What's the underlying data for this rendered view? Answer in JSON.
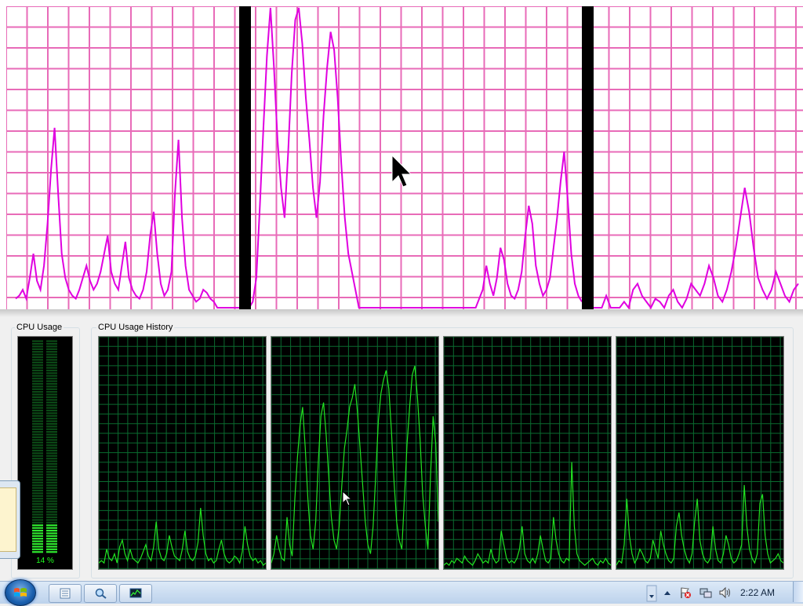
{
  "window": {
    "cpu_usage_label": "CPU Usage",
    "cpu_usage_history_label": "CPU Usage History",
    "cpu_percent_text": "14 %",
    "cpu_percent_value": 14
  },
  "colors": {
    "graph_line": "#21e321",
    "graph_grid": "#0a6b2f",
    "zoom_line": "#e000e0",
    "zoom_grid": "#e86bb8"
  },
  "history": {
    "core_0": [
      2,
      3,
      2,
      8,
      4,
      3,
      6,
      2,
      9,
      12,
      6,
      3,
      8,
      4,
      3,
      2,
      4,
      7,
      10,
      5,
      3,
      9,
      20,
      8,
      4,
      3,
      6,
      14,
      9,
      5,
      4,
      3,
      8,
      16,
      7,
      4,
      3,
      5,
      11,
      26,
      14,
      6,
      3,
      4,
      2,
      3,
      8,
      12,
      6,
      3,
      2,
      3,
      5,
      4,
      2,
      7,
      18,
      10,
      5,
      3,
      4,
      2,
      3,
      1,
      2
    ],
    "core_1": [
      2,
      6,
      14,
      8,
      4,
      3,
      22,
      10,
      5,
      30,
      48,
      62,
      70,
      52,
      30,
      14,
      8,
      20,
      46,
      66,
      72,
      58,
      40,
      22,
      12,
      8,
      18,
      36,
      52,
      60,
      70,
      74,
      80,
      68,
      52,
      36,
      20,
      10,
      6,
      18,
      40,
      64,
      76,
      82,
      86,
      78,
      60,
      38,
      20,
      12,
      8,
      30,
      54,
      70,
      84,
      88,
      74,
      56,
      32,
      18,
      8,
      40,
      66,
      54,
      20
    ],
    "core_2": [
      1,
      2,
      1,
      3,
      2,
      4,
      3,
      2,
      5,
      3,
      2,
      1,
      3,
      6,
      4,
      2,
      3,
      2,
      8,
      4,
      2,
      3,
      16,
      10,
      4,
      2,
      3,
      2,
      4,
      8,
      18,
      6,
      3,
      2,
      4,
      2,
      6,
      14,
      8,
      3,
      2,
      4,
      22,
      12,
      6,
      3,
      2,
      4,
      3,
      46,
      18,
      6,
      3,
      2,
      1,
      2,
      3,
      4,
      2,
      1,
      3,
      2,
      4,
      2,
      1
    ],
    "core_3": [
      1,
      3,
      2,
      10,
      30,
      14,
      6,
      2,
      4,
      8,
      6,
      3,
      2,
      4,
      12,
      8,
      4,
      16,
      10,
      6,
      3,
      2,
      4,
      18,
      24,
      14,
      8,
      4,
      2,
      6,
      20,
      30,
      12,
      6,
      3,
      2,
      4,
      18,
      8,
      3,
      2,
      6,
      14,
      10,
      4,
      2,
      3,
      6,
      10,
      36,
      18,
      8,
      4,
      2,
      6,
      28,
      32,
      14,
      6,
      2,
      3,
      4,
      6,
      3,
      2
    ]
  },
  "zoom_series": [
    3,
    4,
    6,
    3,
    10,
    18,
    9,
    6,
    14,
    28,
    46,
    60,
    38,
    18,
    10,
    6,
    4,
    3,
    6,
    10,
    14,
    9,
    6,
    8,
    12,
    18,
    24,
    12,
    8,
    6,
    14,
    22,
    10,
    6,
    4,
    3,
    6,
    12,
    24,
    32,
    18,
    8,
    4,
    6,
    12,
    38,
    56,
    30,
    14,
    6,
    4,
    2,
    3,
    6,
    5,
    3,
    2,
    0,
    0,
    0,
    0,
    0,
    0,
    0,
    0,
    0,
    0,
    2,
    10,
    34,
    60,
    84,
    100,
    80,
    56,
    40,
    30,
    52,
    78,
    96,
    100,
    88,
    70,
    56,
    40,
    30,
    42,
    64,
    80,
    92,
    86,
    70,
    48,
    30,
    18,
    12,
    6,
    0,
    0,
    0,
    0,
    0,
    0,
    0,
    0,
    0,
    0,
    0,
    0,
    0,
    0,
    0,
    0,
    0,
    0,
    0,
    0,
    0,
    0,
    0,
    0,
    0,
    0,
    0,
    0,
    0,
    0,
    0,
    0,
    0,
    0,
    3,
    6,
    14,
    8,
    4,
    10,
    20,
    16,
    8,
    4,
    3,
    6,
    12,
    24,
    34,
    28,
    14,
    8,
    4,
    6,
    10,
    20,
    30,
    42,
    52,
    36,
    18,
    8,
    4,
    2
  ],
  "zoom_series_right": [
    0,
    0,
    0,
    4,
    0,
    0,
    0,
    2,
    0,
    6,
    8,
    4,
    2,
    0,
    3,
    2,
    0,
    4,
    6,
    2,
    0,
    3,
    8,
    6,
    4,
    8,
    14,
    10,
    4,
    2,
    6,
    12,
    20,
    30,
    40,
    32,
    20,
    10,
    6,
    3,
    6,
    12,
    8,
    4,
    2,
    6,
    8
  ]
}
